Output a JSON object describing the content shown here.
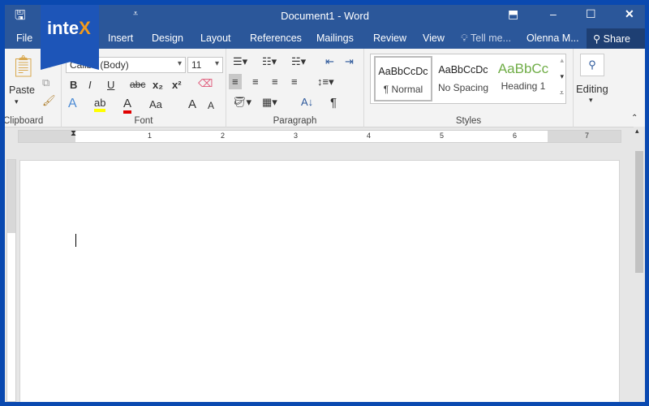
{
  "title": "Document1 - Word",
  "logo": {
    "text_a": "inte",
    "text_b": "X"
  },
  "tabs": [
    "File",
    "Insert",
    "Design",
    "Layout",
    "References",
    "Mailings",
    "Review",
    "View"
  ],
  "tell_me": "Tell me...",
  "user": "Olenna M...",
  "share": "Share",
  "clipboard": {
    "paste": "Paste",
    "label": "Clipboard"
  },
  "font": {
    "name": "Calibri (Body)",
    "size": "11",
    "label": "Font",
    "bold": "B",
    "italic": "I",
    "underline": "U",
    "strike": "abc",
    "sub": "x₂",
    "sup": "x²",
    "case": "Aa",
    "grow": "A",
    "shrink": "A"
  },
  "paragraph": {
    "label": "Paragraph",
    "pilcrow": "¶"
  },
  "styles": {
    "label": "Styles",
    "items": [
      {
        "preview": "AaBbCcDc",
        "name": "¶ Normal"
      },
      {
        "preview": "AaBbCcDc",
        "name": "No Spacing"
      },
      {
        "preview": "AaBbCc",
        "name": "Heading 1"
      }
    ]
  },
  "editing": {
    "label": "Editing"
  },
  "ruler": [
    "1",
    "2",
    "3",
    "4",
    "5",
    "6",
    "7"
  ],
  "colors": {
    "accent": "#2b579a",
    "highlight": "#ffff00",
    "font_color": "#e00000",
    "heading": "#70ad47"
  }
}
